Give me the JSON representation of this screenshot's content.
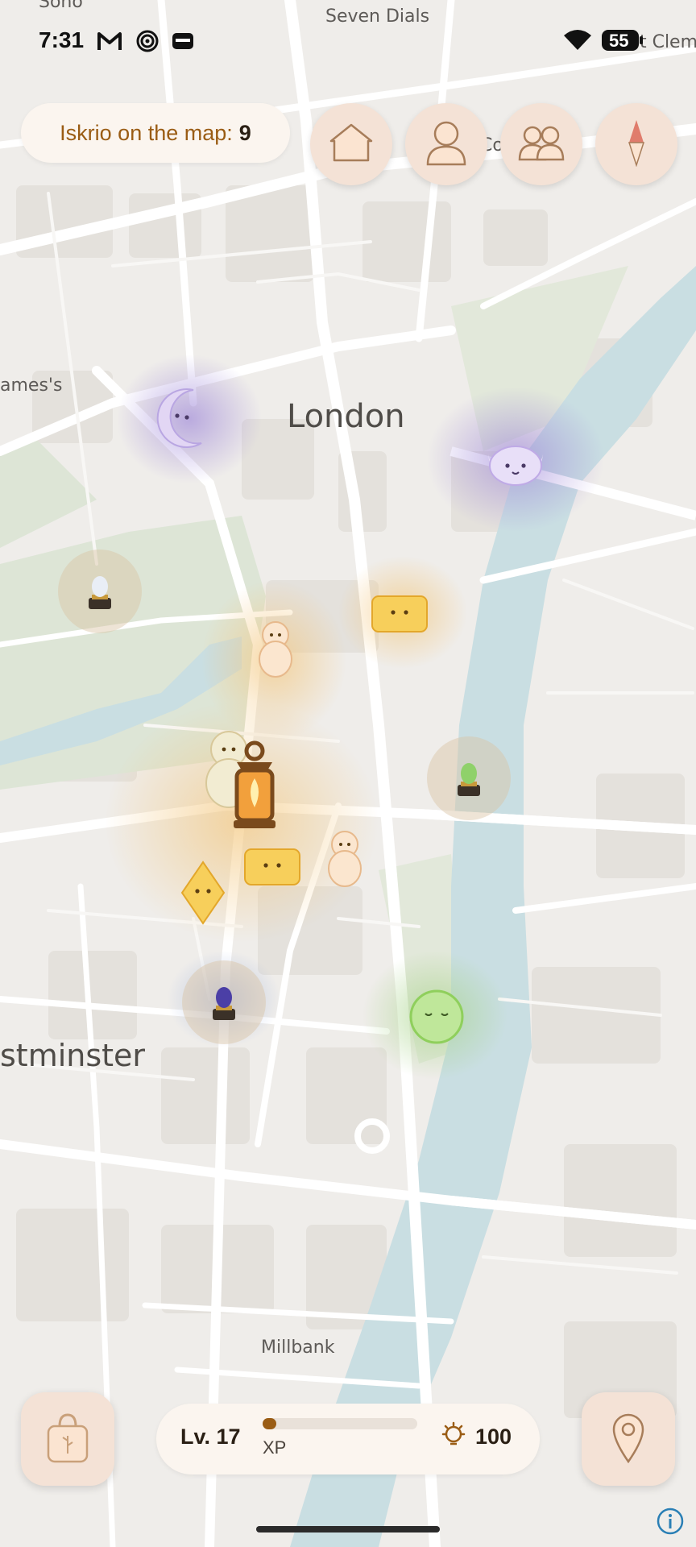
{
  "status_bar": {
    "time": "7:31",
    "battery": "55",
    "icons": [
      "gmail-icon",
      "target-icon",
      "wallet-icon",
      "wifi-icon",
      "battery-icon"
    ]
  },
  "map": {
    "labels": {
      "soho": "Soho",
      "seven_dials": "Seven Dials",
      "st_clement": "St Clem",
      "covent_garden": "Co...rd",
      "st_james": "ames's",
      "london": "London",
      "westminster": "stminster",
      "millbank": "Millbank"
    }
  },
  "top_bar": {
    "counter_label": "Iskrio on the map:",
    "counter_value": "9",
    "buttons": [
      {
        "name": "home-button",
        "icon": "house-icon"
      },
      {
        "name": "profile-button",
        "icon": "person-icon"
      },
      {
        "name": "friends-button",
        "icon": "people-icon"
      },
      {
        "name": "compass-button",
        "icon": "compass-icon"
      }
    ]
  },
  "bottom_bar": {
    "bag_icon": "bag-icon",
    "level_label": "Lv. 17",
    "xp_label": "XP",
    "xp_progress_percent": 9,
    "energy_icon": "lightbulb-icon",
    "energy_value": "100",
    "location_icon": "location-pin-icon",
    "info_icon": "info-icon"
  },
  "colors": {
    "accent_brown": "#9a5c14",
    "button_bg": "#f4e2d6",
    "chip_bg": "#fbf5ef",
    "river": "#c9dee2",
    "park": "#dfe6d7"
  }
}
